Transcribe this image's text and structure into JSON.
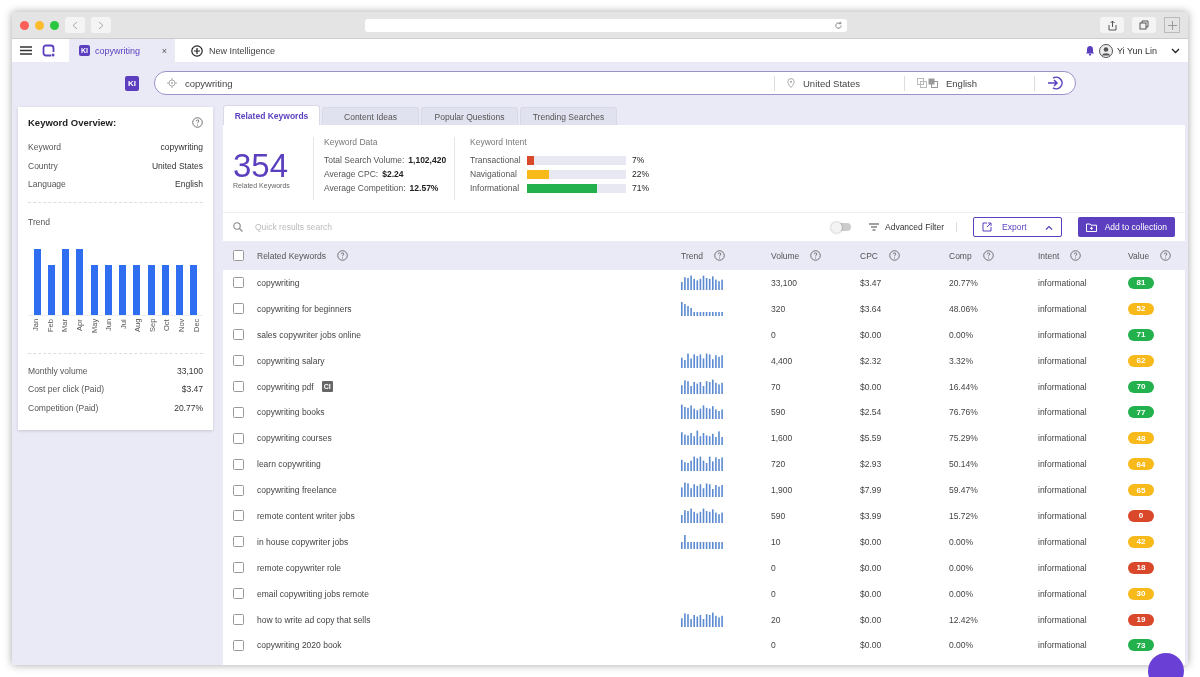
{
  "app_header": {
    "tab": {
      "badge": "KI",
      "label": "copywriting",
      "close": "×"
    },
    "new_tab": "New Intelligence",
    "user": "Yi Yun Lin"
  },
  "search_bar": {
    "badge": "KI",
    "keyword": "copywriting",
    "country": "United States",
    "language": "English"
  },
  "overview": {
    "title": "Keyword Overview:",
    "rows": [
      {
        "label": "Keyword",
        "value": "copywriting"
      },
      {
        "label": "Country",
        "value": "United States"
      },
      {
        "label": "Language",
        "value": "English"
      }
    ],
    "trend_title": "Trend",
    "months": [
      "Jan",
      "Feb",
      "Mar",
      "Apr",
      "May",
      "Jun",
      "Jul",
      "Aug",
      "Sep",
      "Oct",
      "Nov",
      "Dec"
    ],
    "stats": [
      {
        "label": "Monthly volume",
        "value": "33,100"
      },
      {
        "label": "Cost per click (Paid)",
        "value": "$3.47"
      },
      {
        "label": "Competition (Paid)",
        "value": "20.77%"
      }
    ]
  },
  "tabs": [
    {
      "label": "Related Keywords",
      "selected": true
    },
    {
      "label": "Content Ideas",
      "selected": false
    },
    {
      "label": "Popular Questions",
      "selected": false
    },
    {
      "label": "Trending Searches",
      "selected": false
    }
  ],
  "summary": {
    "count": "354",
    "count_label": "Related Keywords",
    "data_title": "Keyword Data",
    "data": [
      {
        "label": "Total Search Volume:",
        "value": "1,102,420"
      },
      {
        "label": "Average CPC:",
        "value": "$2.24"
      },
      {
        "label": "Average Competition:",
        "value": "12.57%"
      }
    ],
    "intent_title": "Keyword Intent",
    "intents": [
      {
        "label": "Transactional",
        "level": 0.07,
        "color": "#d9482b",
        "reading": "7%"
      },
      {
        "label": "Navigational",
        "level": 0.22,
        "color": "#f8b91a",
        "reading": "22%"
      },
      {
        "label": "Informational",
        "level": 0.71,
        "color": "#23b14d",
        "reading": "71%"
      }
    ]
  },
  "toolbar": {
    "placeholder": "Quick results search",
    "filter_on": false,
    "filter": "Advanced Filter",
    "export": "Export",
    "add": "Add to collection"
  },
  "table": {
    "select_all": false,
    "columns": [
      "Related Keywords",
      "Trend",
      "Volume",
      "CPC",
      "Comp",
      "Intent",
      "Value"
    ],
    "rows": [
      {
        "checked": false,
        "keyword": "copywriting",
        "trend": true,
        "volume": "33,100",
        "cpc": "$3.47",
        "comp": "20.77%",
        "intent": "informational",
        "value": "81",
        "color": "#23b14d"
      },
      {
        "checked": false,
        "keyword": "copywriting for beginners",
        "trend": true,
        "volume": "320",
        "cpc": "$3.64",
        "comp": "48.06%",
        "intent": "informational",
        "value": "52",
        "color": "#f8b91a"
      },
      {
        "checked": false,
        "keyword": "sales copywriter jobs online",
        "trend": false,
        "volume": "0",
        "cpc": "$0.00",
        "comp": "0.00%",
        "intent": "informational",
        "value": "71",
        "color": "#23b14d"
      },
      {
        "checked": false,
        "keyword": "copywriting salary",
        "trend": true,
        "volume": "4,400",
        "cpc": "$2.32",
        "comp": "3.32%",
        "intent": "informational",
        "value": "62",
        "color": "#f8b91a"
      },
      {
        "checked": false,
        "keyword": "copywriting pdf",
        "tag": "CI",
        "trend": true,
        "volume": "70",
        "cpc": "$0.00",
        "comp": "16.44%",
        "intent": "informational",
        "value": "70",
        "color": "#23b14d"
      },
      {
        "checked": false,
        "keyword": "copywriting books",
        "trend": true,
        "volume": "590",
        "cpc": "$2.54",
        "comp": "76.76%",
        "intent": "informational",
        "value": "77",
        "color": "#23b14d"
      },
      {
        "checked": false,
        "keyword": "copywriting courses",
        "trend": true,
        "volume": "1,600",
        "cpc": "$5.59",
        "comp": "75.29%",
        "intent": "informational",
        "value": "48",
        "color": "#f8b91a"
      },
      {
        "checked": false,
        "keyword": "learn copywriting",
        "trend": true,
        "volume": "720",
        "cpc": "$2.93",
        "comp": "50.14%",
        "intent": "informational",
        "value": "64",
        "color": "#f8b91a"
      },
      {
        "checked": false,
        "keyword": "copywriting freelance",
        "trend": true,
        "volume": "1,900",
        "cpc": "$7.99",
        "comp": "59.47%",
        "intent": "informational",
        "value": "65",
        "color": "#f8b91a"
      },
      {
        "checked": false,
        "keyword": "remote content writer jobs",
        "trend": true,
        "volume": "590",
        "cpc": "$3.99",
        "comp": "15.72%",
        "intent": "informational",
        "value": "0",
        "color": "#d9482b"
      },
      {
        "checked": false,
        "keyword": "in house copywriter jobs",
        "trend": true,
        "volume": "10",
        "cpc": "$0.00",
        "comp": "0.00%",
        "intent": "informational",
        "value": "42",
        "color": "#f8b91a"
      },
      {
        "checked": false,
        "keyword": "remote copywriter role",
        "trend": false,
        "volume": "0",
        "cpc": "$0.00",
        "comp": "0.00%",
        "intent": "informational",
        "value": "18",
        "color": "#d9482b"
      },
      {
        "checked": false,
        "keyword": "email copywriting jobs remote",
        "trend": false,
        "volume": "0",
        "cpc": "$0.00",
        "comp": "0.00%",
        "intent": "informational",
        "value": "30",
        "color": "#f8b91a"
      },
      {
        "checked": false,
        "keyword": "how to write ad copy that sells",
        "trend": true,
        "volume": "20",
        "cpc": "$0.00",
        "comp": "12.42%",
        "intent": "informational",
        "value": "19",
        "color": "#d9482b"
      },
      {
        "checked": false,
        "keyword": "copywriting 2020 book",
        "trend": false,
        "volume": "0",
        "cpc": "$0.00",
        "comp": "0.00%",
        "intent": "informational",
        "value": "73",
        "color": "#23b14d"
      }
    ]
  }
}
